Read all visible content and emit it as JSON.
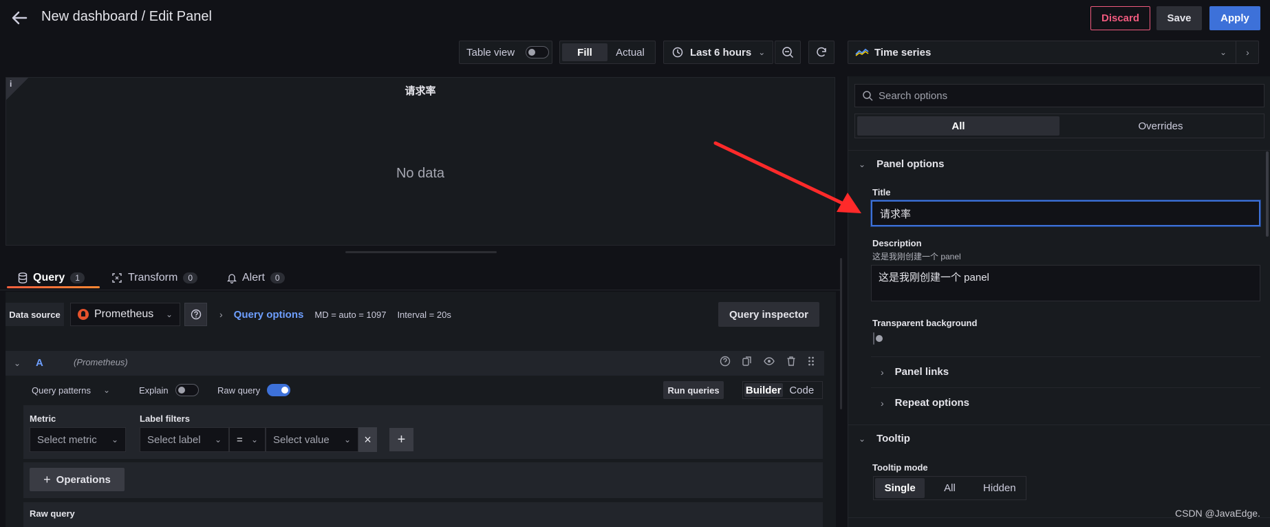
{
  "header": {
    "title": "New dashboard / Edit Panel",
    "discard_label": "Discard",
    "save_label": "Save",
    "apply_label": "Apply"
  },
  "toolbar": {
    "table_view_label": "Table view",
    "table_view_on": false,
    "fill_label": "Fill",
    "actual_label": "Actual",
    "time_range": "Last 6 hours",
    "visualization": "Time series"
  },
  "preview": {
    "panel_title": "请求率",
    "empty_text": "No data",
    "info_icon": "i"
  },
  "tabs": [
    {
      "label": "Query",
      "count": "1",
      "icon": "database-icon"
    },
    {
      "label": "Transform",
      "count": "0",
      "icon": "transform-icon"
    },
    {
      "label": "Alert",
      "count": "0",
      "icon": "bell-icon"
    }
  ],
  "datasource": {
    "label": "Data source",
    "name": "Prometheus",
    "query_options_label": "Query options",
    "md_text": "MD = auto = 1097",
    "interval_text": "Interval = 20s",
    "inspector_label": "Query inspector"
  },
  "query": {
    "ref_id": "A",
    "source": "(Prometheus)",
    "patterns_label": "Query patterns",
    "explain_label": "Explain",
    "explain_on": false,
    "raw_query_label": "Raw query",
    "raw_query_on": true,
    "run_label": "Run queries",
    "builder_label": "Builder",
    "code_label": "Code",
    "metric_label": "Metric",
    "metric_placeholder": "Select metric",
    "label_filters_label": "Label filters",
    "label_placeholder": "Select label",
    "operator": "=",
    "value_placeholder": "Select value",
    "operations_label": "Operations",
    "raw_section_label": "Raw query"
  },
  "options": {
    "search_placeholder": "Search options",
    "all_label": "All",
    "overrides_label": "Overrides",
    "panel_options_label": "Panel options",
    "title_label": "Title",
    "title_value": "请求率",
    "description_label": "Description",
    "description_hint": "这是我刚创建一个 panel",
    "description_value": "这是我刚创建一个 panel",
    "transparent_label": "Transparent background",
    "panel_links_label": "Panel links",
    "repeat_options_label": "Repeat options",
    "tooltip_label": "Tooltip",
    "tooltip_mode_label": "Tooltip mode",
    "tooltip_modes": [
      "Single",
      "All",
      "Hidden"
    ]
  },
  "watermark": "CSDN @JavaEdge.",
  "colors": {
    "accent": "#3d71d9",
    "discard": "#f05a7e",
    "tab_underline": "#f55f3e",
    "link": "#6e9fff",
    "arrow": "#ff2a2a"
  }
}
